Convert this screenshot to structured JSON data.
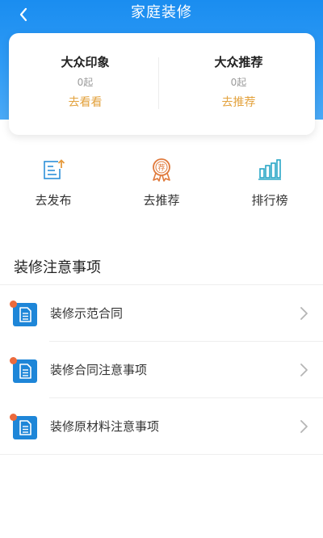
{
  "header": {
    "title": "家庭装修"
  },
  "colors": {
    "primary": "#1a8df0",
    "accent": "#e3a23d",
    "badge": "#ec6a3c",
    "icon_blue": "#1e86d8"
  },
  "summary": {
    "left": {
      "title": "大众印象",
      "count": "0起",
      "link": "去看看"
    },
    "right": {
      "title": "大众推荐",
      "count": "0起",
      "link": "去推荐"
    }
  },
  "quick_actions": [
    {
      "label": "去发布",
      "icon": "publish-icon"
    },
    {
      "label": "去推荐",
      "icon": "recommend-badge-icon"
    },
    {
      "label": "排行榜",
      "icon": "ranking-chart-icon"
    }
  ],
  "section": {
    "title": "装修注意事项"
  },
  "notes": [
    {
      "label": "装修示范合同",
      "icon": "document-icon"
    },
    {
      "label": "装修合同注意事项",
      "icon": "document-icon"
    },
    {
      "label": "装修原材料注意事项",
      "icon": "document-icon"
    }
  ]
}
